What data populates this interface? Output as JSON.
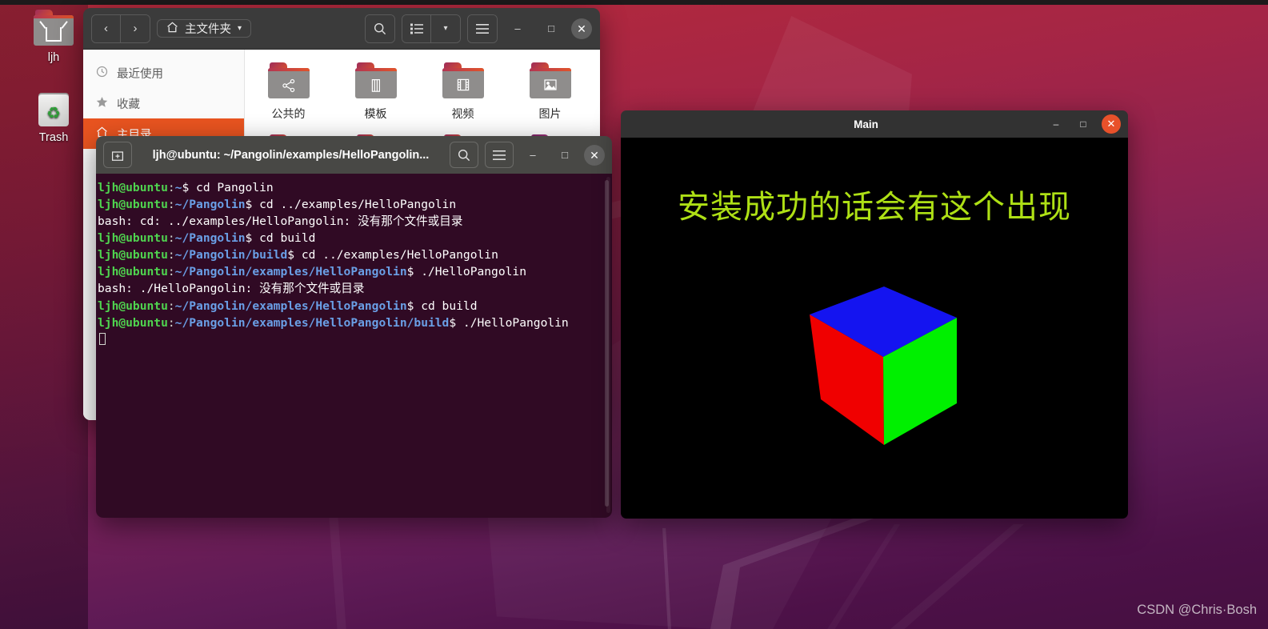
{
  "desktop": {
    "icons": [
      {
        "label": "ljh",
        "icon": "home-folder-icon"
      },
      {
        "label": "Trash",
        "icon": "trash-icon"
      }
    ],
    "watermark": "CSDN @Chris·Bosh",
    "wallpaper_colors": {
      "top": "#b52b3c",
      "bottom": "#450f40"
    }
  },
  "file_manager": {
    "window_title": "主文件夹",
    "nav": {
      "back": "‹",
      "forward": "›"
    },
    "path_label": "主文件夹",
    "path_icon": "home-icon",
    "dropdown_caret": "▾",
    "toolbar": {
      "search_icon": "search-icon",
      "view_list_icon": "list-view-icon",
      "view_caret": "▾",
      "menu_icon": "hamburger-menu-icon"
    },
    "window_controls": {
      "minimize": "–",
      "maximize": "□",
      "close": "✕"
    },
    "sidebar": [
      {
        "label": "最近使用",
        "icon": "clock-icon",
        "active": false
      },
      {
        "label": "收藏",
        "icon": "star-icon",
        "active": false
      },
      {
        "label": "主目录",
        "icon": "home-icon",
        "active": true
      }
    ],
    "folders_row1": [
      {
        "label": "公共的",
        "glyph": "⎇",
        "icon": "share-folder-icon",
        "type": "folder"
      },
      {
        "label": "模板",
        "glyph": "▥",
        "icon": "templates-folder-icon",
        "type": "folder"
      },
      {
        "label": "视频",
        "glyph": "⬚",
        "icon": "videos-folder-icon",
        "type": "folder"
      },
      {
        "label": "图片",
        "glyph": "⛰",
        "icon": "pictures-folder-icon",
        "type": "folder"
      }
    ],
    "folders_row2": [
      {
        "label": "",
        "glyph": "▭",
        "icon": "documents-folder-icon",
        "type": "folder"
      },
      {
        "label": "",
        "glyph": "▫",
        "icon": "music-folder-icon",
        "type": "folder"
      },
      {
        "label": "",
        "glyph": "◢",
        "icon": "downloads-folder-icon",
        "type": "folder"
      },
      {
        "label": "",
        "glyph": "",
        "icon": "image-thumbnail",
        "type": "image"
      }
    ]
  },
  "terminal": {
    "title": "ljh@ubuntu: ~/Pangolin/examples/HelloPangolin...",
    "new_tab_icon": "new-tab-icon",
    "search_icon": "search-icon",
    "menu_icon": "hamburger-menu-icon",
    "window_controls": {
      "minimize": "–",
      "maximize": "□",
      "close": "✕"
    },
    "colors": {
      "background": "#300a24",
      "user": "#4fd44f",
      "path": "#6a9fe6",
      "text": "#ffffff"
    },
    "lines": [
      {
        "type": "prompt",
        "user": "ljh@ubuntu",
        "path": "~",
        "command": " cd Pangolin"
      },
      {
        "type": "prompt",
        "user": "ljh@ubuntu",
        "path": "~/Pangolin",
        "command": " cd ../examples/HelloPangolin"
      },
      {
        "type": "output",
        "text": "bash: cd: ../examples/HelloPangolin: 没有那个文件或目录"
      },
      {
        "type": "prompt",
        "user": "ljh@ubuntu",
        "path": "~/Pangolin",
        "command": " cd build"
      },
      {
        "type": "prompt",
        "user": "ljh@ubuntu",
        "path": "~/Pangolin/build",
        "command": " cd ../examples/HelloPangolin"
      },
      {
        "type": "prompt",
        "user": "ljh@ubuntu",
        "path": "~/Pangolin/examples/HelloPangolin",
        "command": " ./HelloPangolin"
      },
      {
        "type": "output",
        "text": "bash: ./HelloPangolin: 没有那个文件或目录"
      },
      {
        "type": "prompt",
        "user": "ljh@ubuntu",
        "path": "~/Pangolin/examples/HelloPangolin",
        "command": " cd build"
      },
      {
        "type": "prompt",
        "user": "ljh@ubuntu",
        "path": "~/Pangolin/examples/HelloPangolin/build",
        "command": " ./HelloPangolin"
      }
    ]
  },
  "pangolin": {
    "title": "Main",
    "window_controls": {
      "minimize": "–",
      "maximize": "□",
      "close": "✕"
    },
    "overlay_text": "安装成功的话会有这个出现",
    "overlay_color": "#aee015",
    "canvas_background": "#000000",
    "cube": {
      "faces": [
        {
          "name": "top-face",
          "color": "#1414f0"
        },
        {
          "name": "left-face",
          "color": "#f00000"
        },
        {
          "name": "right-face",
          "color": "#00f000"
        }
      ]
    }
  }
}
